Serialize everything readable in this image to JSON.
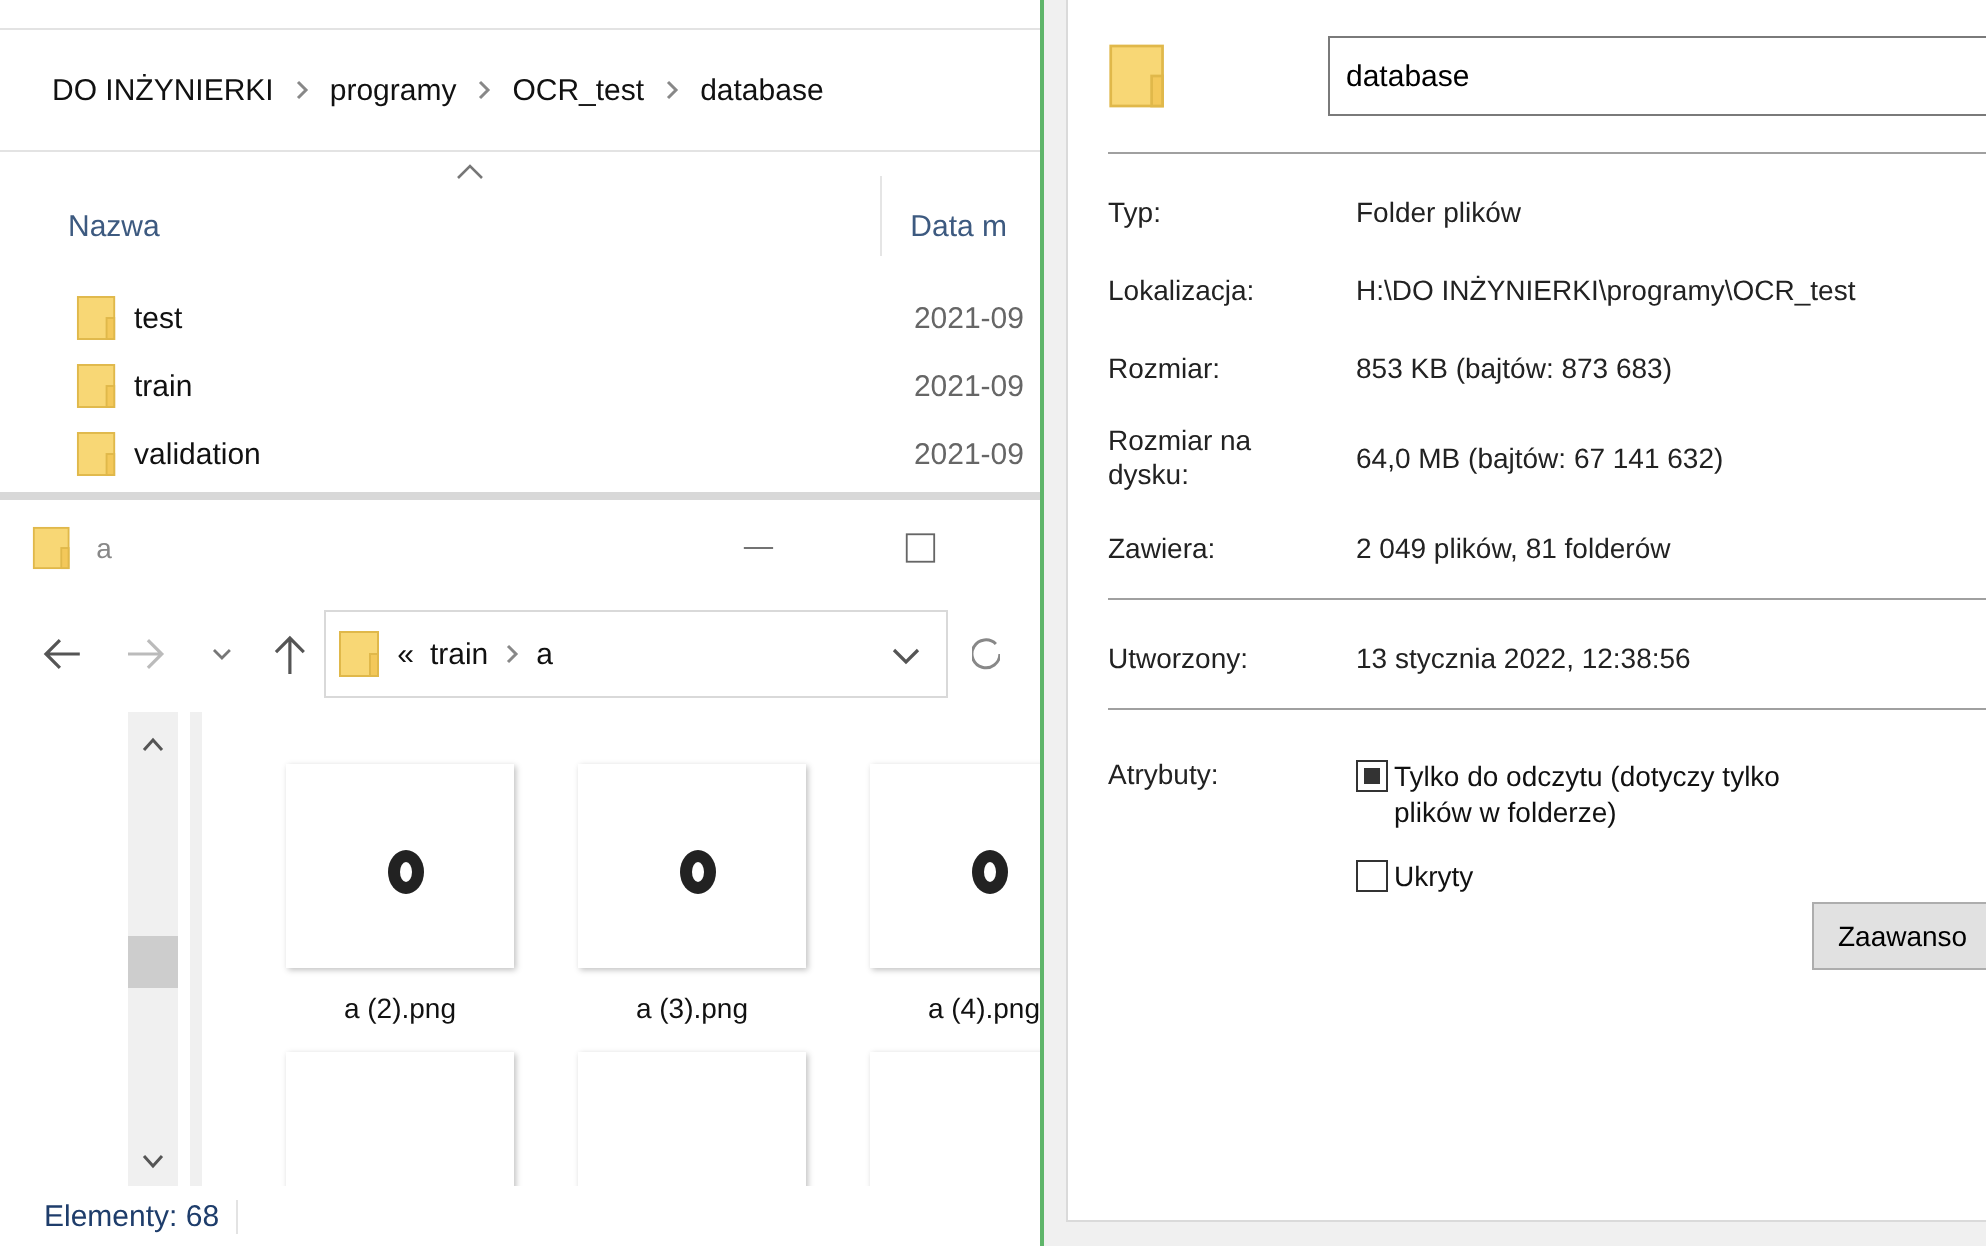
{
  "top_window": {
    "breadcrumb": [
      "DO INŻYNIERKI",
      "programy",
      "OCR_test",
      "database"
    ],
    "columns": [
      "Nazwa",
      "Data m"
    ],
    "rows": [
      {
        "name": "test",
        "date": "2021-09"
      },
      {
        "name": "train",
        "date": "2021-09"
      },
      {
        "name": "validation",
        "date": "2021-09"
      }
    ]
  },
  "bottom_window": {
    "title": "a",
    "address": {
      "overflow": "«",
      "path": [
        "train",
        "a"
      ]
    },
    "files": [
      {
        "name": "a (2).png",
        "kind": "picture"
      },
      {
        "name": "a (3).png",
        "kind": "picture"
      },
      {
        "name": "a (4).png",
        "kind": "picture"
      },
      {
        "kind": "picture"
      },
      {
        "kind": "picture"
      },
      {
        "kind": "picture"
      }
    ],
    "status": "Elementy: 68"
  },
  "properties": {
    "name": "database",
    "groups": [
      [
        {
          "label": "Typ:",
          "value": "Folder plików"
        },
        {
          "label": "Lokalizacja:",
          "value": "H:\\DO INŻYNIERKI\\programy\\OCR_test"
        },
        {
          "label": "Rozmiar:",
          "value": "853 KB (bajtów: 873 683)"
        },
        {
          "label": "Rozmiar na dysku:",
          "value": "64,0 MB (bajtów: 67 141 632)"
        },
        {
          "label": "Zawiera:",
          "value": "2 049 plików, 81 folderów"
        }
      ],
      [
        {
          "label": "Utworzony:",
          "value": "13 stycznia 2022, 12:38:56"
        }
      ]
    ],
    "attributes_label": "Atrybuty:",
    "attributes": [
      {
        "label": "Tylko do odczytu (dotyczy tylko plików w folderze)",
        "checked": false,
        "indeterminate": true
      },
      {
        "label": "Ukryty",
        "checked": false,
        "indeterminate": false
      }
    ],
    "advanced_button": "Zaawanso"
  }
}
